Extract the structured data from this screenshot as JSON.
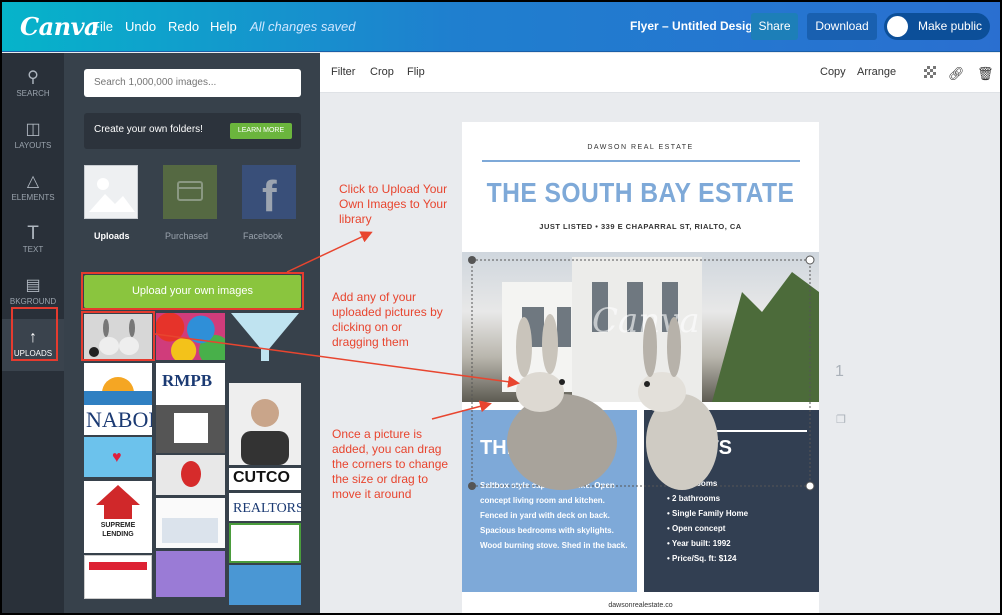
{
  "app": {
    "logo": "Canva"
  },
  "menu": [
    "File",
    "Undo",
    "Redo",
    "Help"
  ],
  "status": "All changes saved",
  "doc_title": "Flyer – Untitled Design",
  "share_label": "Share",
  "download_label": "Download",
  "make_public_label": "Make public",
  "rail": [
    {
      "label": "SEARCH",
      "icon": "search-icon"
    },
    {
      "label": "LAYOUTS",
      "icon": "layouts-icon"
    },
    {
      "label": "ELEMENTS",
      "icon": "elements-icon"
    },
    {
      "label": "TEXT",
      "icon": "text-icon"
    },
    {
      "label": "BKGROUND",
      "icon": "background-icon"
    },
    {
      "label": "UPLOADS",
      "icon": "upload-icon"
    }
  ],
  "search_placeholder": "Search 1,000,000 images...",
  "folders": {
    "text": "Create your own folders!",
    "button": "LEARN MORE"
  },
  "sources": [
    {
      "label": "Uploads"
    },
    {
      "label": "Purchased"
    },
    {
      "label": "Facebook"
    }
  ],
  "upload_button": "Upload your own images",
  "thumb_labels": {
    "nabor": "NABOR",
    "rmpb": "RMPB",
    "cutco": "CUTCO",
    "supreme": "SUPREME\nLENDING",
    "realtors": "REALTORS"
  },
  "toolbar": {
    "left": [
      "Filter",
      "Crop",
      "Flip"
    ],
    "copy": "Copy",
    "arrange": "Arrange"
  },
  "page_number": "1",
  "flyer": {
    "company": "DAWSON REAL ESTATE",
    "title": "THE SOUTH BAY ESTATE",
    "subtitle": "JUST LISTED  •  339 E CHAPARRAL ST, RIALTO, CA",
    "left_heading": "THE",
    "right_heading": "CTS",
    "description": "Saltbox style cape cod home. Open concept living room and kitchen. Fenced in yard with deck on back. Spacious bedrooms with skylights. Wood burning stove. Shed in the back.",
    "facts": [
      "3 bedrooms",
      "2 bathrooms",
      "Single Family Home",
      "Open concept",
      "Year built: 1992",
      "Price/Sq. ft: $124"
    ],
    "footer": "dawsonrealestate.co",
    "watermark": "Canva"
  },
  "annotations": {
    "upload": "Click to Upload Your Own Images to Your library",
    "add": "Add any of your uploaded pictures by clicking on or dragging them",
    "resize": "Once a picture is added, you can drag the corners to change the size or drag to move it around"
  },
  "colors": {
    "accent_green": "#8ac53e",
    "flyer_blue": "#7ea9d8",
    "flyer_navy": "#323f52",
    "annotation_red": "#e8452f"
  }
}
